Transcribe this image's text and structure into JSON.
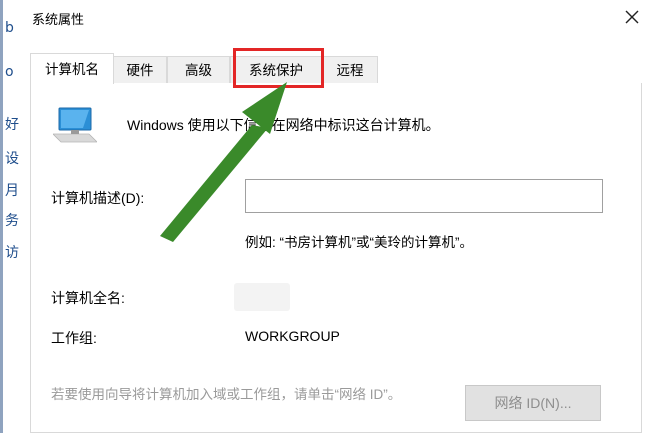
{
  "window": {
    "title": "系统属性",
    "close_icon": "close-icon"
  },
  "background_window": {
    "glyphs": [
      "b",
      "o",
      "好",
      "设",
      "月",
      "务",
      "访"
    ]
  },
  "tabs": [
    {
      "label": "计算机名",
      "active": true
    },
    {
      "label": "硬件",
      "active": false
    },
    {
      "label": "高级",
      "active": false
    },
    {
      "label": "系统保护",
      "active": false
    },
    {
      "label": "远程",
      "active": false
    }
  ],
  "computer_name_tab": {
    "icon": "monitor-icon",
    "info_text": "Windows 使用以下信息在网络中标识这台计算机。",
    "description_label": "计算机描述(D):",
    "description_value": "",
    "example_text": "例如: “书房计算机”或“美玲的计算机”。",
    "full_name_label": "计算机全名:",
    "full_name_value": "",
    "workgroup_label": "工作组:",
    "workgroup_value": "WORKGROUP",
    "join_hint": "若要使用向导将计算机加入域或工作组，请单击“网络 ID”。",
    "network_id_button": "网络 ID(N)..."
  },
  "annotation": {
    "highlight_color": "#e32626",
    "arrow_color": "#3a8a2a",
    "highlighted_tab": "系统保护"
  }
}
